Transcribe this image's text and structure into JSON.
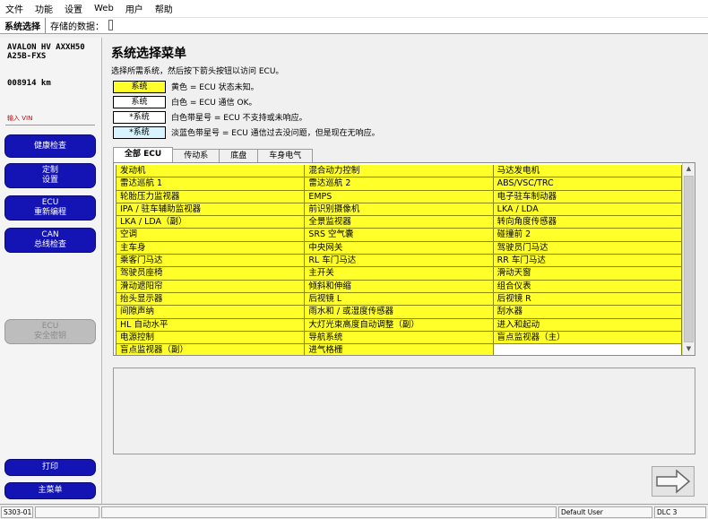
{
  "menubar": {
    "items": [
      "文件",
      "功能",
      "设置",
      "Web",
      "用户",
      "帮助"
    ]
  },
  "tabstrip": {
    "active_tab": "系统选择",
    "saved_data_label": "存储的数据："
  },
  "vehicle": {
    "model": "AVALON HV AXXH50\nA25B-FXS",
    "odometer": "008914 km",
    "vin_label": "输入 VIN"
  },
  "sidebar": {
    "health_check": "健康检查",
    "customize": [
      "定制",
      "设置"
    ],
    "ecu_reprogram": [
      "ECU",
      "重新编程"
    ],
    "can_check": [
      "CAN",
      "总线检查"
    ],
    "ecu_security": [
      "ECU",
      "安全密钥"
    ],
    "print": "打印",
    "main_menu": "主菜单"
  },
  "main": {
    "title": "系统选择菜单",
    "instruction": "选择所需系统，然后按下箭头按钮以访问 ECU。",
    "legend": [
      {
        "label": "系统",
        "desc": "黄色 = ECU 状态未知。",
        "color": "#ffff2a"
      },
      {
        "label": "系统",
        "desc": "白色 = ECU 通信 OK。",
        "color": "#ffffff"
      },
      {
        "label": "*系统",
        "desc": "白色带星号 =  ECU 不支持或未响应。",
        "color": "#ffffff"
      },
      {
        "label": "*系统",
        "desc": "淡蓝色带星号 = ECU 通信过去没问题，但是现在无响应。",
        "color": "#d8f4ff"
      }
    ],
    "ecu_tabs": [
      "全部 ECU",
      "传动系",
      "底盘",
      "车身电气"
    ]
  },
  "ecu_grid": [
    [
      "发动机",
      "混合动力控制",
      "马达发电机"
    ],
    [
      "雷达巡航 1",
      "雷达巡航 2",
      "ABS/VSC/TRC"
    ],
    [
      "轮胎压力监视器",
      "EMPS",
      "电子驻车制动器"
    ],
    [
      "IPA / 驻车辅助监视器",
      "前识别摄像机",
      "LKA / LDA"
    ],
    [
      "LKA / LDA（副）",
      "全景监视器",
      "转向角度传感器"
    ],
    [
      "空调",
      "SRS 空气囊",
      "碰撞前 2"
    ],
    [
      "主车身",
      "中央网关",
      "驾驶员门马达"
    ],
    [
      "乘客门马达",
      "RL 车门马达",
      "RR 车门马达"
    ],
    [
      "驾驶员座椅",
      "主开关",
      "滑动天窗"
    ],
    [
      "滑动遮阳帘",
      "倾斜和伸缩",
      "组合仪表"
    ],
    [
      "抬头显示器",
      "后视镜 L",
      "后视镜 R"
    ],
    [
      "间隙声纳",
      "雨水和 / 或湿度传感器",
      "刮水器"
    ],
    [
      "HL 自动水平",
      "大灯光束高度自动调整（副）",
      "进入和起动"
    ],
    [
      "电源控制",
      "导航系统",
      "盲点监视器（主）"
    ],
    [
      "盲点监视器（副）",
      "进气格栅",
      ""
    ]
  ],
  "statusbar": {
    "code": "S303-01",
    "user": "Default User",
    "port": "DLC 3"
  }
}
